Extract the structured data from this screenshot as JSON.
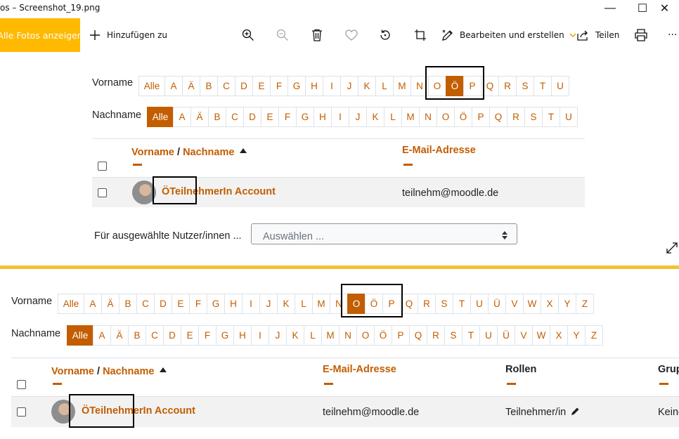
{
  "window": {
    "title": "os – Screenshot_19.png",
    "minimize_glyph": "—",
    "maximize_glyph": "☐",
    "close_glyph": "✕"
  },
  "toolbar": {
    "all_photos": "Alle Fotos anzeigen",
    "add_to": "Hinzufügen zu",
    "edit_create": "Bearbeiten und erstellen",
    "share": "Teilen",
    "more": "···",
    "icons": [
      "zoom-in-icon",
      "zoom-out-icon",
      "delete-icon",
      "favorite-icon",
      "rotate-icon",
      "crop-icon",
      "edit-icon",
      "share-icon",
      "print-icon"
    ]
  },
  "top": {
    "firstname_label": "Vorname",
    "lastname_label": "Nachname",
    "firstname_letters": [
      "Alle",
      "A",
      "Ä",
      "B",
      "C",
      "D",
      "E",
      "F",
      "G",
      "H",
      "I",
      "J",
      "K",
      "L",
      "M",
      "N",
      "O",
      "Ö",
      "P",
      "Q",
      "R",
      "S",
      "T",
      "U"
    ],
    "firstname_active": "Ö",
    "lastname_letters": [
      "Alle",
      "A",
      "Ä",
      "B",
      "C",
      "D",
      "E",
      "F",
      "G",
      "H",
      "I",
      "J",
      "K",
      "L",
      "M",
      "N",
      "O",
      "Ö",
      "P",
      "Q",
      "R",
      "S",
      "T",
      "U"
    ],
    "lastname_active": "Alle",
    "col_firstname": "Vorname",
    "col_sep": "/",
    "col_lastname": "Nachname",
    "col_email": "E-Mail-Adresse",
    "row": {
      "name": "ÖTeilnehmerIn Account",
      "email": "teilnehm@moodle.de"
    },
    "bulk_label": "Für ausgewählte Nutzer/innen ...",
    "bulk_select": "Auswählen ..."
  },
  "bottom": {
    "firstname_label": "Vorname",
    "lastname_label": "Nachname",
    "firstname_letters": [
      "Alle",
      "A",
      "Ä",
      "B",
      "C",
      "D",
      "E",
      "F",
      "G",
      "H",
      "I",
      "J",
      "K",
      "L",
      "M",
      "N",
      "O",
      "Ö",
      "P",
      "Q",
      "R",
      "S",
      "T",
      "U",
      "Ü",
      "V",
      "W",
      "X",
      "Y",
      "Z"
    ],
    "firstname_active": "O",
    "lastname_letters": [
      "Alle",
      "A",
      "Ä",
      "B",
      "C",
      "D",
      "E",
      "F",
      "G",
      "H",
      "I",
      "J",
      "K",
      "L",
      "M",
      "N",
      "O",
      "Ö",
      "P",
      "Q",
      "R",
      "S",
      "T",
      "U",
      "Ü",
      "V",
      "W",
      "X",
      "Y",
      "Z"
    ],
    "lastname_active": "Alle",
    "col_firstname": "Vorname",
    "col_sep": "/",
    "col_lastname": "Nachname",
    "col_email": "E-Mail-Adresse",
    "col_roles": "Rollen",
    "col_groups": "Gruppen",
    "row": {
      "name": "ÖTeilnehmerIn Account",
      "email": "teilnehm@moodle.de",
      "role": "Teilnehmer/in",
      "groups": "Keine"
    }
  },
  "colors": {
    "accent": "#c25d00",
    "photos_yellow": "#ffb900",
    "divider": "#f0c431"
  }
}
